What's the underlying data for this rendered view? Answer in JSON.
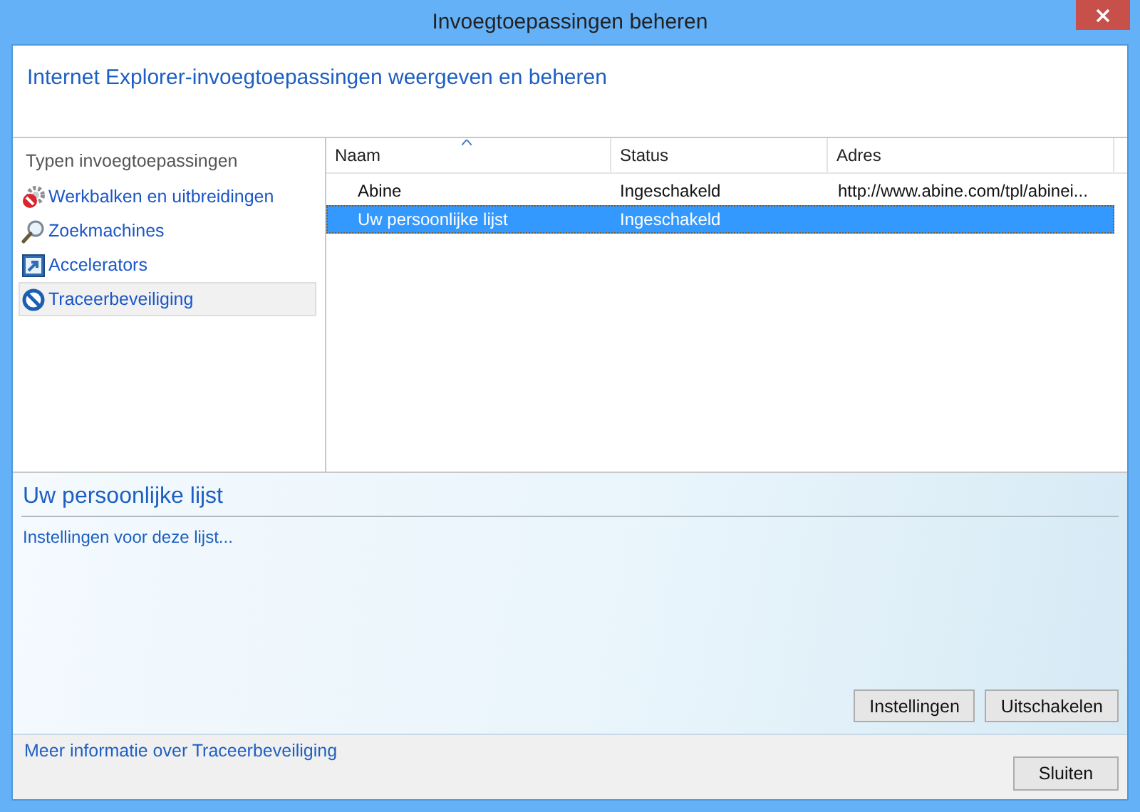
{
  "window": {
    "title": "Invoegtoepassingen beheren"
  },
  "header": "Internet Explorer-invoegtoepassingen weergeven en beheren",
  "sidebar": {
    "heading": "Typen invoegtoepassingen",
    "items": [
      {
        "label": "Werkbalken en uitbreidingen",
        "kind": "toolbar",
        "selected": false
      },
      {
        "label": "Zoekmachines",
        "kind": "search",
        "selected": false
      },
      {
        "label": "Accelerators",
        "kind": "accelerator",
        "selected": false
      },
      {
        "label": "Traceerbeveiliging",
        "kind": "tracking",
        "selected": true
      }
    ]
  },
  "table": {
    "columns": [
      {
        "label": "Naam",
        "sorted": true
      },
      {
        "label": "Status",
        "sorted": false
      },
      {
        "label": "Adres",
        "sorted": false
      }
    ],
    "rows": [
      {
        "cells": [
          "Abine",
          "Ingeschakeld",
          "http://www.abine.com/tpl/abinei..."
        ],
        "selected": false
      },
      {
        "cells": [
          "Uw persoonlijke lijst",
          "Ingeschakeld"
        ],
        "selected": true
      }
    ]
  },
  "details": {
    "title": "Uw persoonlijke lijst",
    "link": "Instellingen voor deze lijst...",
    "buttons": [
      "Instellingen",
      "Uitschakelen"
    ]
  },
  "footer": {
    "link": "Meer informatie over Traceerbeveiliging",
    "button": "Sluiten"
  }
}
